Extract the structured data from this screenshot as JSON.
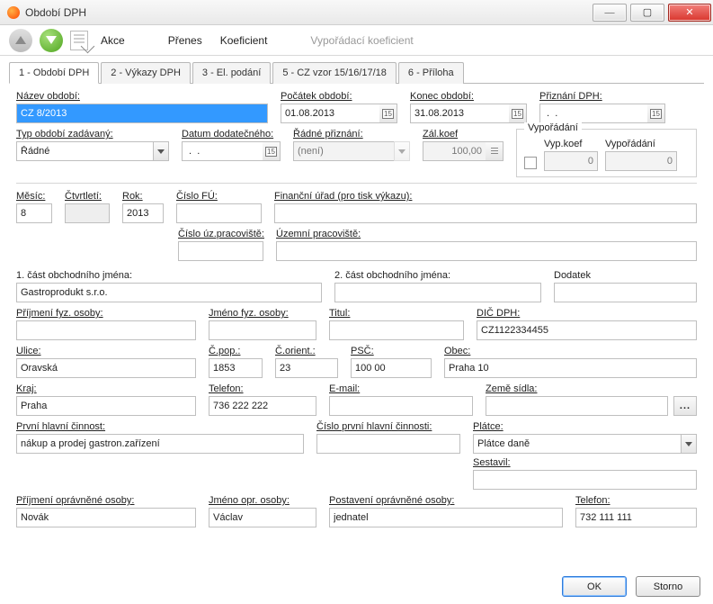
{
  "window": {
    "title": "Období DPH"
  },
  "toolbar": {
    "akce": "Akce",
    "prenes": "Přenes",
    "koeficient": "Koeficient",
    "vypor_koef": "Vypořádací koeficient"
  },
  "tabs": [
    {
      "label": "1 - Období DPH"
    },
    {
      "label": "2 - Výkazy DPH"
    },
    {
      "label": "3 - El. podání"
    },
    {
      "label": "5 - CZ vzor 15/16/17/18"
    },
    {
      "label": "6 - Příloha"
    }
  ],
  "row1_labels": {
    "nazev": "Název období:",
    "pocatek": "Počátek období:",
    "konec": "Konec období:",
    "priznani": "Přiznání DPH:"
  },
  "row1_values": {
    "nazev": "CZ 8/2013",
    "pocatek": "01.08.2013",
    "konec": "31.08.2013",
    "priznani": " .  ."
  },
  "row2_labels": {
    "typ": "Typ období zadávaný:",
    "datum_dod": "Datum dodatečného:",
    "radne_pr": "Řádné přiznání:",
    "zalkoef": "Zál.koef"
  },
  "row2_values": {
    "typ": "Řádné",
    "datum_dod": " .  .",
    "radne_pr": "(není)",
    "zalkoef": "100,00"
  },
  "vyp_group": {
    "legend": "Vypořádání",
    "vypkoef_lbl": "Vyp.koef",
    "vypkoef_val": "0",
    "vypor_lbl": "Vypořádání",
    "vypor_val": "0"
  },
  "row3_labels": {
    "mesic": "Měsíc:",
    "ctvrtleti": "Čtvrtletí:",
    "rok": "Rok:",
    "cislo_fu": "Číslo FÚ:",
    "fin_urad": "Finanční úřad (pro tisk výkazu):",
    "cislo_uz": "Číslo úz.pracoviště:",
    "uzemni": "Územní pracoviště:"
  },
  "row3_values": {
    "mesic": "8",
    "ctvrtleti": "",
    "rok": "2013",
    "cislo_fu": "",
    "fin_urad": "",
    "cislo_uz": "",
    "uzemni": ""
  },
  "row4_labels": {
    "cast1": "1. část obchodního jména:",
    "cast2": "2. část obchodního jména:",
    "dodatek": "Dodatek"
  },
  "row4_values": {
    "cast1": "Gastroprodukt s.r.o.",
    "cast2": "",
    "dodatek": ""
  },
  "row5_labels": {
    "prijmeni_fyz": "Příjmení fyz. osoby:",
    "jmeno_fyz": "Jméno fyz. osoby:",
    "titul": "Titul:",
    "dic": "DIČ DPH:"
  },
  "row5_values": {
    "prijmeni_fyz": "",
    "jmeno_fyz": "",
    "titul": "",
    "dic": "CZ1122334455"
  },
  "row6_labels": {
    "ulice": "Ulice:",
    "cpop": "Č.pop.:",
    "corient": "Č.orient.:",
    "psc": "PSČ:",
    "obec": "Obec:"
  },
  "row6_values": {
    "ulice": "Oravská",
    "cpop": "1853",
    "corient": "23",
    "psc": "100 00",
    "obec": "Praha 10"
  },
  "row7_labels": {
    "kraj": "Kraj:",
    "telefon": "Telefon:",
    "email": "E-mail:",
    "zeme": "Země sídla:"
  },
  "row7_values": {
    "kraj": "Praha",
    "telefon": "736 222 222",
    "email": "",
    "zeme": ""
  },
  "row8_labels": {
    "prvni_cinnost": "První hlavní činnost:",
    "cislo_cinnost": "Číslo první hlavní činnosti:",
    "platce": "Plátce:",
    "sestavil": "Sestavil:"
  },
  "row8_values": {
    "prvni_cinnost": "nákup a prodej gastron.zařízení",
    "cislo_cinnost": "",
    "platce": "Plátce daně",
    "sestavil": ""
  },
  "row9_labels": {
    "prijmeni_opr": "Příjmení oprávněné osoby:",
    "jmeno_opr": "Jméno opr. osoby:",
    "postaveni": "Postavení oprávněné osoby:",
    "telefon": "Telefon:"
  },
  "row9_values": {
    "prijmeni_opr": "Novák",
    "jmeno_opr": "Václav",
    "postaveni": "jednatel",
    "telefon": "732 111 111"
  },
  "ellipsis": "...",
  "footer": {
    "ok": "OK",
    "storno": "Storno"
  }
}
